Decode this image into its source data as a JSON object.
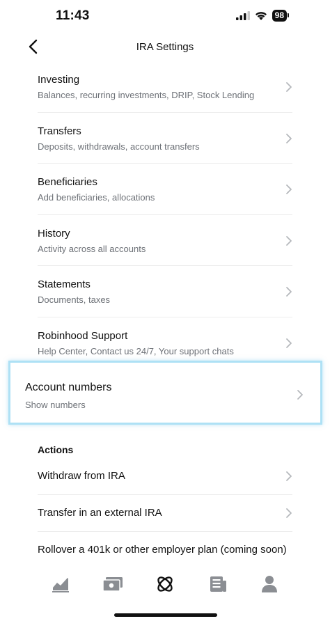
{
  "status_bar": {
    "time": "11:43",
    "battery": "98",
    "icons": [
      "signal-icon",
      "wifi-icon",
      "battery-icon"
    ]
  },
  "nav": {
    "title": "IRA Settings",
    "back_icon": "chevron-left-icon"
  },
  "settings": [
    {
      "title": "Investing",
      "subtitle": "Balances, recurring investments, DRIP, Stock Lending"
    },
    {
      "title": "Transfers",
      "subtitle": "Deposits, withdrawals, account transfers"
    },
    {
      "title": "Beneficiaries",
      "subtitle": "Add beneficiaries, allocations"
    },
    {
      "title": "History",
      "subtitle": "Activity across all accounts"
    },
    {
      "title": "Statements",
      "subtitle": "Documents, taxes"
    },
    {
      "title": "Robinhood Support",
      "subtitle": "Help Center, Contact us 24/7, Your support chats"
    }
  ],
  "account_numbers": {
    "title": "Account numbers",
    "subtitle": "Show numbers",
    "highlight_color": "#aee1f5"
  },
  "actions": {
    "heading": "Actions",
    "items": [
      {
        "label": "Withdraw from IRA"
      },
      {
        "label": "Transfer in an external IRA"
      },
      {
        "label": "Rollover a 401k or other employer plan (coming soon)"
      }
    ]
  },
  "tabbar": {
    "tabs": [
      "chart-icon",
      "cash-icon",
      "crypto-icon",
      "news-icon",
      "account-icon"
    ],
    "active": "crypto-icon"
  },
  "colors": {
    "text": "#111111",
    "subtext": "#6d7177",
    "chevron": "#b5b8bc",
    "divider": "#ececec",
    "tab_inactive": "#8b8e93"
  }
}
